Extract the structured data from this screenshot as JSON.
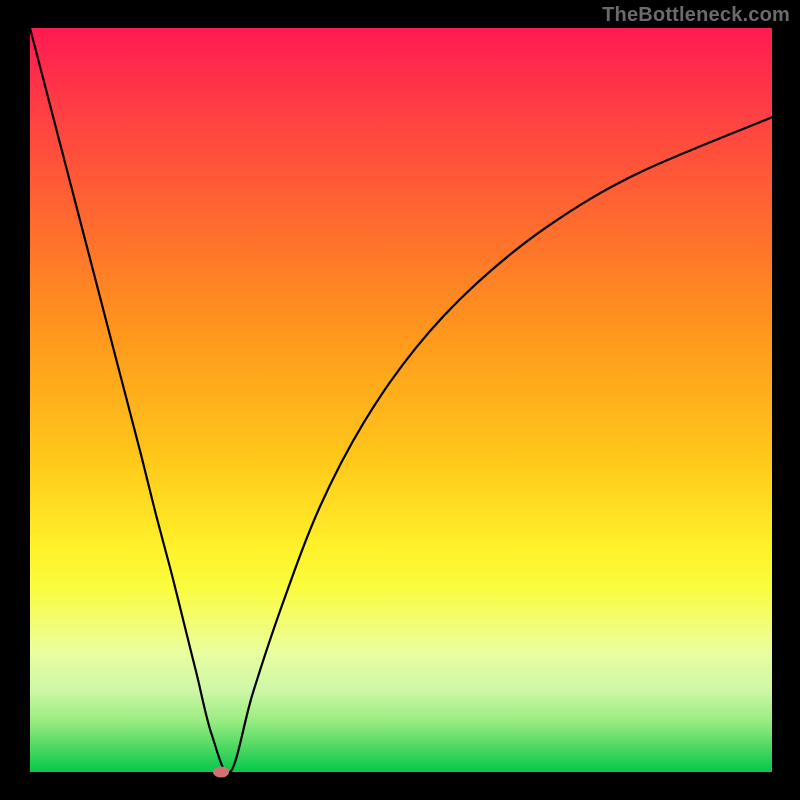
{
  "watermark": "TheBottleneck.com",
  "chart_data": {
    "type": "line",
    "title": "",
    "xlabel": "",
    "ylabel": "",
    "xlim": [
      0,
      100
    ],
    "ylim": [
      0,
      100
    ],
    "grid": false,
    "legend": false,
    "series": [
      {
        "name": "bottleneck-curve",
        "x": [
          0,
          3,
          6,
          9,
          12,
          15,
          17,
          19,
          21,
          22.5,
          24.5,
          27,
          30,
          34,
          39,
          45,
          52,
          60,
          70,
          82,
          100
        ],
        "y": [
          100,
          88.5,
          77,
          65.5,
          54,
          42.5,
          34.5,
          27,
          19,
          13,
          5,
          0,
          10.5,
          22.5,
          35.5,
          47,
          57,
          65.5,
          73.5,
          80.5,
          88
        ]
      }
    ],
    "marker": {
      "x": 25.8,
      "y": 0,
      "color": "#d17272"
    },
    "gradient_stops": [
      {
        "pos": 0.0,
        "color": "#ff1a52"
      },
      {
        "pos": 0.26,
        "color": "#ff6a2f"
      },
      {
        "pos": 0.58,
        "color": "#ffc81a"
      },
      {
        "pos": 0.8,
        "color": "#f2fd73"
      },
      {
        "pos": 1.0,
        "color": "#04c84a"
      }
    ]
  }
}
